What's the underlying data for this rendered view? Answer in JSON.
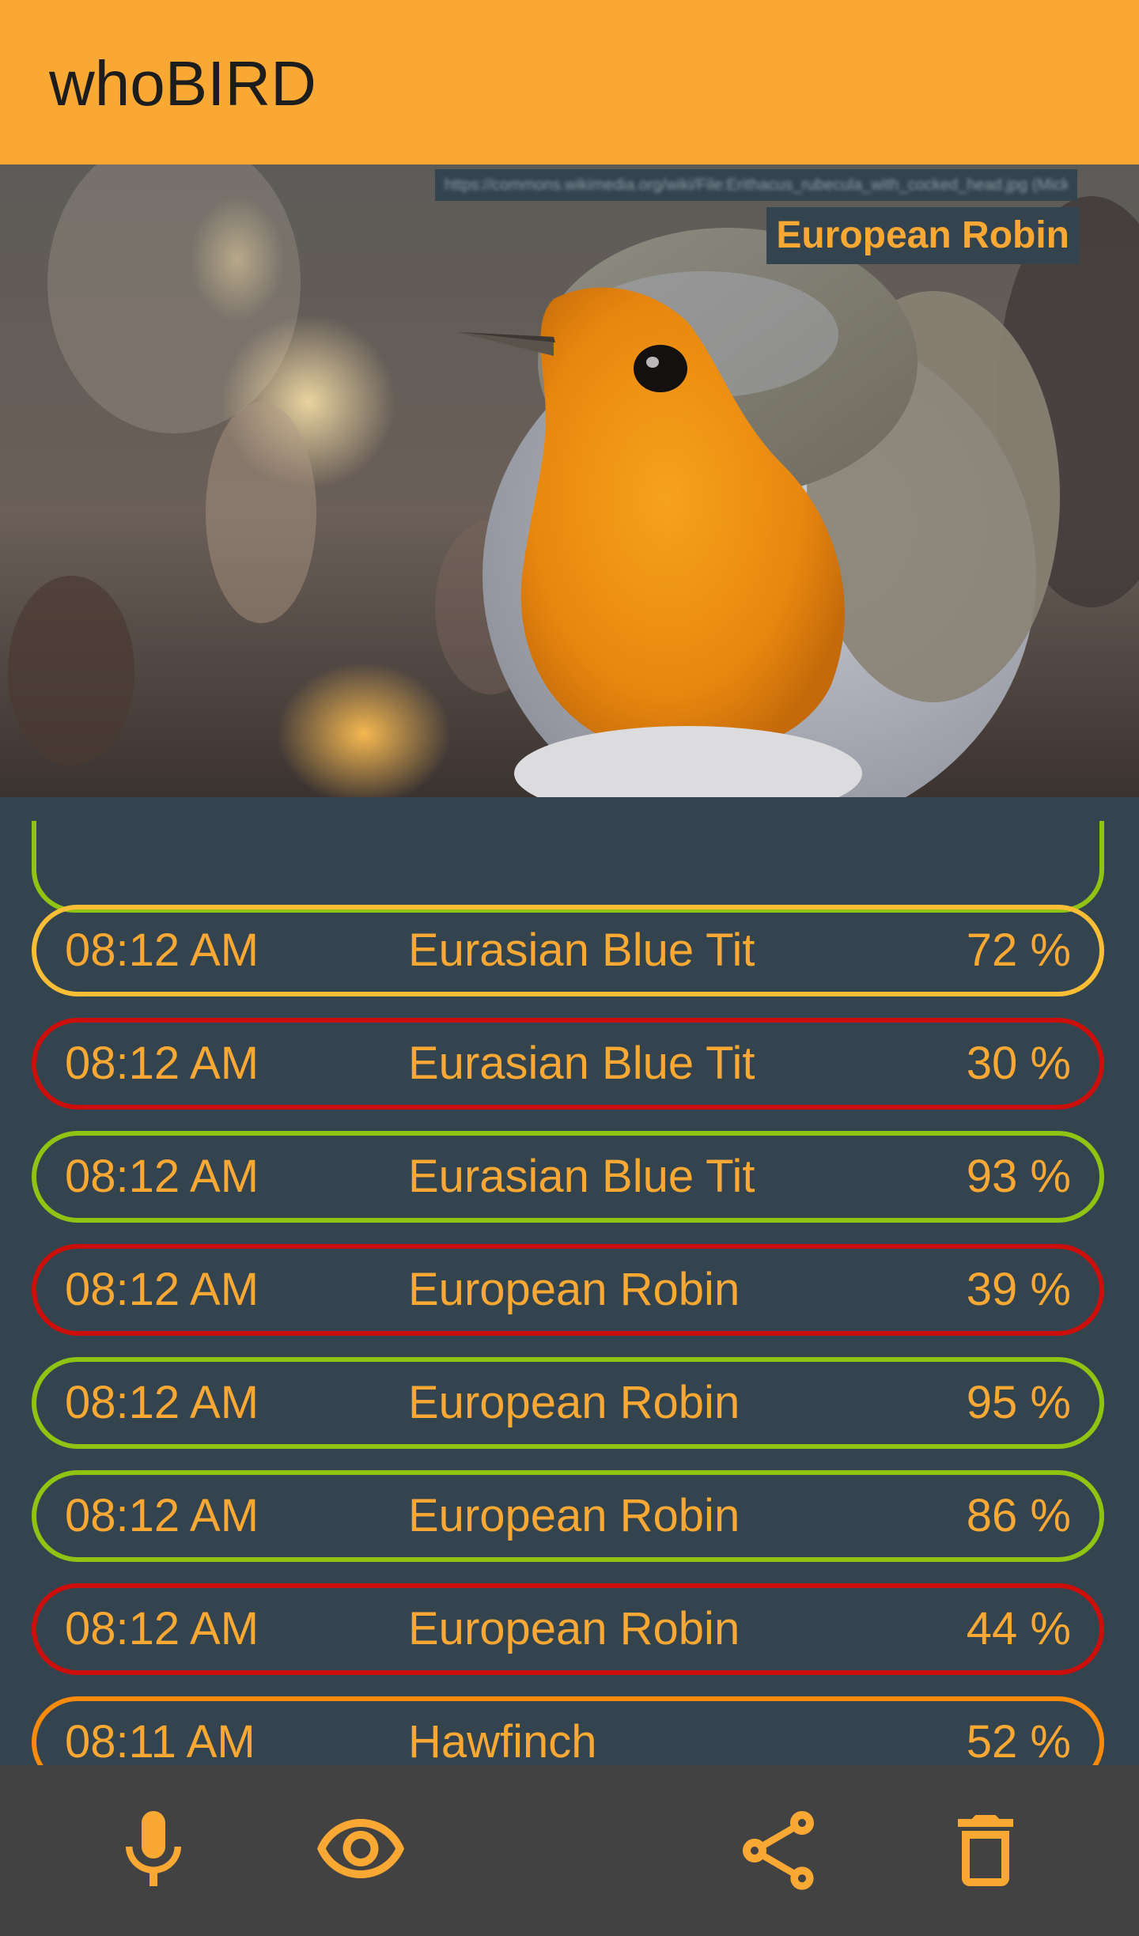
{
  "app": {
    "title": "whoBIRD"
  },
  "hero": {
    "species": "European Robin",
    "credit_text": "https://commons.wikimedia.org/wiki/File:Erithacus_rubecula_with_cocked_head.jpg (Mick Lobb)"
  },
  "detections": [
    {
      "time": "08:12 AM",
      "species": "Eurasian Blue Tit",
      "confidence": "72 %",
      "confidence_value": 72,
      "border_color": "#f9be35"
    },
    {
      "time": "08:12 AM",
      "species": "Eurasian Blue Tit",
      "confidence": "30 %",
      "confidence_value": 30,
      "border_color": "#cc0f0b"
    },
    {
      "time": "08:12 AM",
      "species": "Eurasian Blue Tit",
      "confidence": "93 %",
      "confidence_value": 93,
      "border_color": "#8fc412"
    },
    {
      "time": "08:12 AM",
      "species": "European Robin",
      "confidence": "39 %",
      "confidence_value": 39,
      "border_color": "#cc0f0b"
    },
    {
      "time": "08:12 AM",
      "species": "European Robin",
      "confidence": "95 %",
      "confidence_value": 95,
      "border_color": "#8fc412"
    },
    {
      "time": "08:12 AM",
      "species": "European Robin",
      "confidence": "86 %",
      "confidence_value": 86,
      "border_color": "#8fc412"
    },
    {
      "time": "08:12 AM",
      "species": "European Robin",
      "confidence": "44 %",
      "confidence_value": 44,
      "border_color": "#cc0f0b"
    },
    {
      "time": "08:11 AM",
      "species": "Hawfinch",
      "confidence": "52 %",
      "confidence_value": 52,
      "border_color": "#f98a0a"
    }
  ],
  "partial_row_border_color": "#8fc412",
  "bottom_nav": {
    "items": [
      {
        "icon": "microphone-icon"
      },
      {
        "icon": "eye-icon"
      },
      {
        "icon": "share-icon"
      },
      {
        "icon": "trash-icon"
      }
    ]
  },
  "colors": {
    "accent": "#f9a834",
    "background": "#34444f",
    "bottom_bar": "#424242",
    "high_confidence": "#8fc412",
    "medium_confidence": "#f9be35",
    "low_confidence": "#cc0f0b",
    "mid_low_confidence": "#f98a0a"
  }
}
